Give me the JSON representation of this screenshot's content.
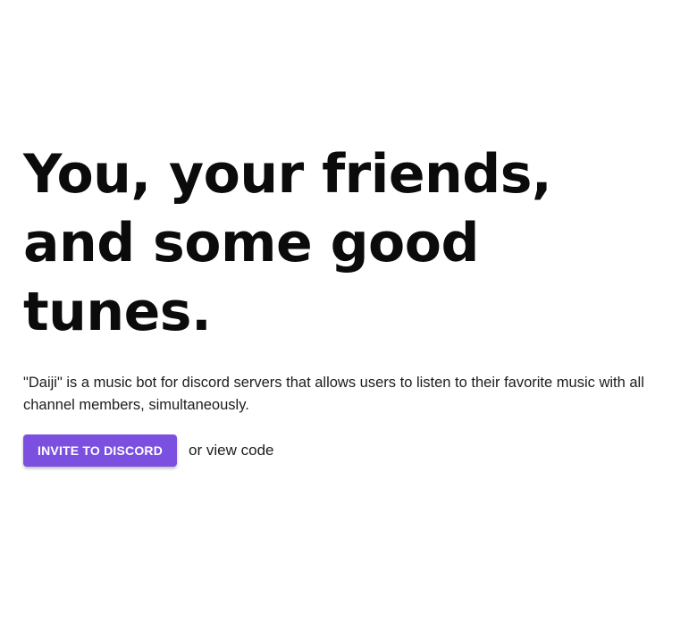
{
  "hero": {
    "headline": "You, your friends, and some good tunes.",
    "description": "\"Daiji\" is a music bot for discord servers that allows users to listen to their favorite music with all channel members, simultaneously.",
    "invite_label": "INVITE TO DISCORD",
    "view_code_label": "or view code"
  },
  "colors": {
    "accent": "#7b4fe0",
    "text": "#111111",
    "background": "#ffffff"
  }
}
